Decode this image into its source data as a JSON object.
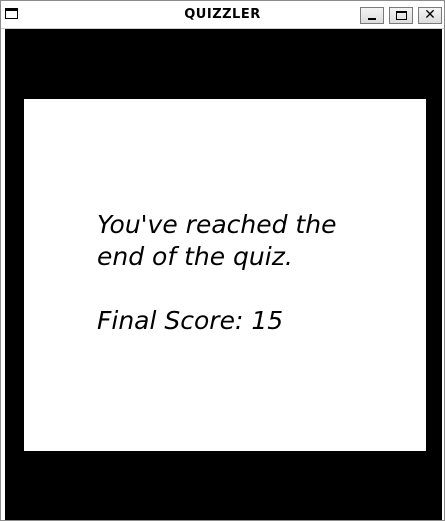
{
  "window": {
    "title": "QUIZZLER",
    "close_glyph": "✕",
    "icons": {
      "app": "window-icon",
      "minimize": "minimize-icon",
      "maximize": "maximize-icon",
      "close": "close-icon"
    }
  },
  "card": {
    "text": "You've reached the\nend of the quiz.\n\nFinal Score: 15"
  },
  "colors": {
    "background": "#000000",
    "card": "#ffffff",
    "text": "#000000"
  }
}
